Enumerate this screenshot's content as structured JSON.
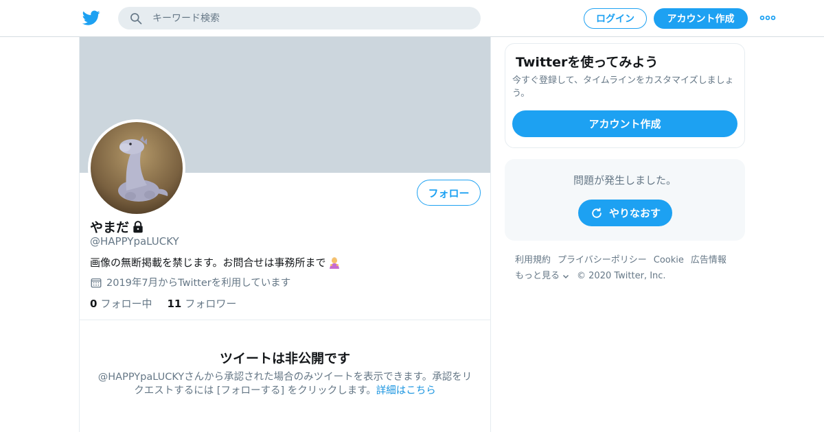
{
  "header": {
    "search_placeholder": "キーワード検索",
    "login_label": "ログイン",
    "signup_label": "アカウント作成",
    "brand_color": "#1da1f2"
  },
  "profile": {
    "display_name": "やまだ",
    "handle": "@HAPPYpaLUCKY",
    "bio": "画像の無断掲載を禁じます。お問合せは事務所まで",
    "joined": "2019年7月からTwitterを利用しています",
    "following_count": "0",
    "following_label": "フォロー中",
    "followers_count": "11",
    "followers_label": "フォロワー",
    "follow_button": "フォロー"
  },
  "protected": {
    "title": "ツイートは非公開です",
    "description": "@HAPPYpaLUCKYさんから承認された場合のみツイートを表示できます。承認をリクエストするには [フォローする] をクリックします。",
    "link": "詳細はこちら"
  },
  "sidebar": {
    "signup_card": {
      "title": "Twitterを使ってみよう",
      "description": "今すぐ登録して、タイムラインをカスタマイズしましょう。",
      "button": "アカウント作成"
    },
    "error_card": {
      "message": "問題が発生しました。",
      "retry_button": "やりなおす"
    },
    "footer": {
      "links": [
        "利用規約",
        "プライバシーポリシー",
        "Cookie",
        "広告情報"
      ],
      "more": "もっと見る",
      "copyright": "© 2020 Twitter, Inc."
    }
  }
}
